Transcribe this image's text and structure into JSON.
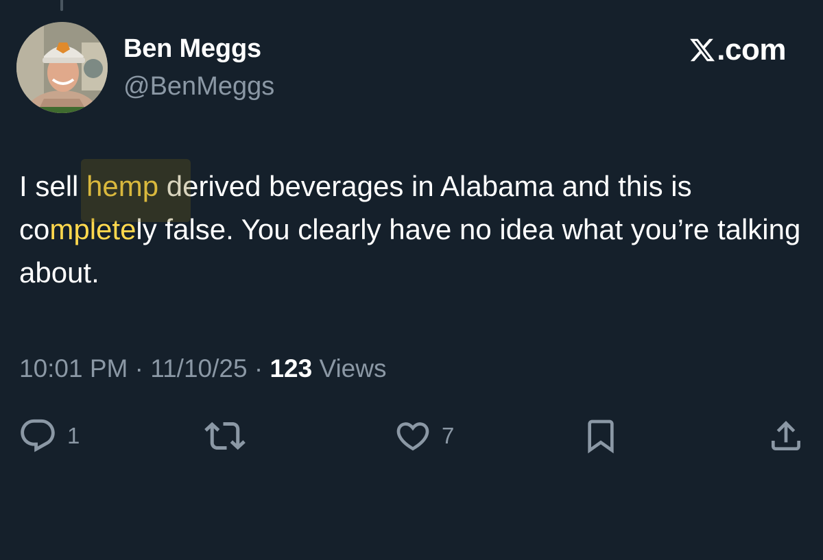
{
  "user": {
    "display_name": "Ben Meggs",
    "handle": "@BenMeggs"
  },
  "brand": {
    "label": ".com",
    "icon": "x-logo-icon"
  },
  "tweet": {
    "text_segments": [
      "I sell ",
      "hemp",
      " derived beverages in Alabama and this is co",
      "mplete",
      "ly false. You clearly have no idea what you’re talking about."
    ],
    "highlight_color": "#ffd84d"
  },
  "meta": {
    "time": "10:01 PM",
    "sep1": " · ",
    "date": "11/10/25",
    "sep2": " · ",
    "views_count": "123",
    "views_label": " Views"
  },
  "actions": {
    "reply": {
      "icon": "reply-icon",
      "count": "1"
    },
    "repost": {
      "icon": "repost-icon",
      "count": ""
    },
    "like": {
      "icon": "heart-icon",
      "count": "7"
    },
    "bookmark": {
      "icon": "bookmark-icon"
    },
    "share": {
      "icon": "share-icon"
    }
  },
  "colors": {
    "background": "#15202b",
    "secondary_text": "#8b98a5",
    "primary_text": "#ffffff"
  }
}
